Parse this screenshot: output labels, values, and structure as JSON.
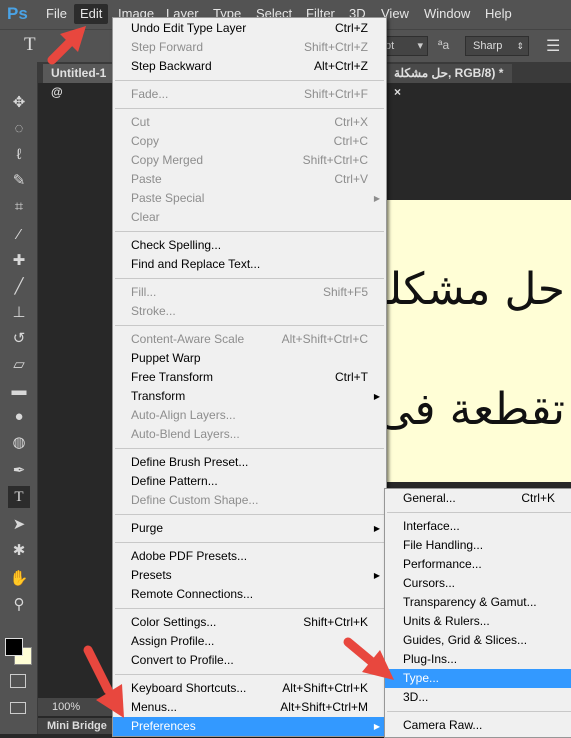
{
  "menubar": {
    "logo": "Ps",
    "items": [
      "File",
      "Edit",
      "Image",
      "Layer",
      "Type",
      "Select",
      "Filter",
      "3D",
      "View",
      "Window",
      "Help"
    ],
    "active": "Edit"
  },
  "options": {
    "antialias": "Sharp",
    "size_suffix": "pt"
  },
  "tabs": {
    "doc1": "Untitled-1 @",
    "doc2": "حل مشكلة, RGB/8) *",
    "close": "×"
  },
  "canvas": {
    "line1": "حل مشكلة ال",
    "line2": "تقطعة فى برن",
    "bg": "#fffed6"
  },
  "status": {
    "zoom": "100%",
    "panel": "Mini Bridge"
  },
  "edit_menu": [
    {
      "label": "Undo Edit Type Layer",
      "shortcut": "Ctrl+Z"
    },
    {
      "label": "Step Forward",
      "shortcut": "Shift+Ctrl+Z",
      "disabled": true
    },
    {
      "label": "Step Backward",
      "shortcut": "Alt+Ctrl+Z"
    },
    {
      "sep": true
    },
    {
      "label": "Fade...",
      "shortcut": "Shift+Ctrl+F",
      "disabled": true
    },
    {
      "sep": true
    },
    {
      "label": "Cut",
      "shortcut": "Ctrl+X",
      "disabled": true
    },
    {
      "label": "Copy",
      "shortcut": "Ctrl+C",
      "disabled": true
    },
    {
      "label": "Copy Merged",
      "shortcut": "Shift+Ctrl+C",
      "disabled": true
    },
    {
      "label": "Paste",
      "shortcut": "Ctrl+V",
      "disabled": true
    },
    {
      "label": "Paste Special",
      "submenu": true,
      "disabled": true
    },
    {
      "label": "Clear",
      "disabled": true
    },
    {
      "sep": true
    },
    {
      "label": "Check Spelling..."
    },
    {
      "label": "Find and Replace Text..."
    },
    {
      "sep": true
    },
    {
      "label": "Fill...",
      "shortcut": "Shift+F5",
      "disabled": true
    },
    {
      "label": "Stroke...",
      "disabled": true
    },
    {
      "sep": true
    },
    {
      "label": "Content-Aware Scale",
      "shortcut": "Alt+Shift+Ctrl+C",
      "disabled": true
    },
    {
      "label": "Puppet Warp"
    },
    {
      "label": "Free Transform",
      "shortcut": "Ctrl+T"
    },
    {
      "label": "Transform",
      "submenu": true
    },
    {
      "label": "Auto-Align Layers...",
      "disabled": true
    },
    {
      "label": "Auto-Blend Layers...",
      "disabled": true
    },
    {
      "sep": true
    },
    {
      "label": "Define Brush Preset..."
    },
    {
      "label": "Define Pattern..."
    },
    {
      "label": "Define Custom Shape...",
      "disabled": true
    },
    {
      "sep": true
    },
    {
      "label": "Purge",
      "submenu": true
    },
    {
      "sep": true
    },
    {
      "label": "Adobe PDF Presets..."
    },
    {
      "label": "Presets",
      "submenu": true
    },
    {
      "label": "Remote Connections..."
    },
    {
      "sep": true
    },
    {
      "label": "Color Settings...",
      "shortcut": "Shift+Ctrl+K"
    },
    {
      "label": "Assign Profile..."
    },
    {
      "label": "Convert to Profile..."
    },
    {
      "sep": true
    },
    {
      "label": "Keyboard Shortcuts...",
      "shortcut": "Alt+Shift+Ctrl+K"
    },
    {
      "label": "Menus...",
      "shortcut": "Alt+Shift+Ctrl+M"
    },
    {
      "label": "Preferences",
      "submenu": true,
      "highlighted": true
    }
  ],
  "prefs_menu": [
    {
      "label": "General...",
      "shortcut": "Ctrl+K"
    },
    {
      "sep": true
    },
    {
      "label": "Interface..."
    },
    {
      "label": "File Handling..."
    },
    {
      "label": "Performance..."
    },
    {
      "label": "Cursors..."
    },
    {
      "label": "Transparency & Gamut..."
    },
    {
      "label": "Units & Rulers..."
    },
    {
      "label": "Guides, Grid & Slices..."
    },
    {
      "label": "Plug-Ins..."
    },
    {
      "label": "Type...",
      "highlighted": true
    },
    {
      "label": "3D..."
    },
    {
      "sep": true
    },
    {
      "label": "Camera Raw..."
    }
  ],
  "tools": [
    "move-icon",
    "marquee-icon",
    "lasso-icon",
    "quick-select-icon",
    "crop-icon",
    "eyedropper-icon",
    "healing-icon",
    "brush-icon",
    "stamp-icon",
    "history-brush-icon",
    "eraser-icon",
    "gradient-icon",
    "blur-icon",
    "dodge-icon",
    "pen-icon",
    "type-icon",
    "path-select-icon",
    "shape-icon",
    "hand-icon",
    "zoom-icon"
  ],
  "colors": {
    "accent": "#3399ff",
    "annotation_arrow": "#e8473e",
    "foreground": "#000000",
    "background": "#fffed6"
  }
}
